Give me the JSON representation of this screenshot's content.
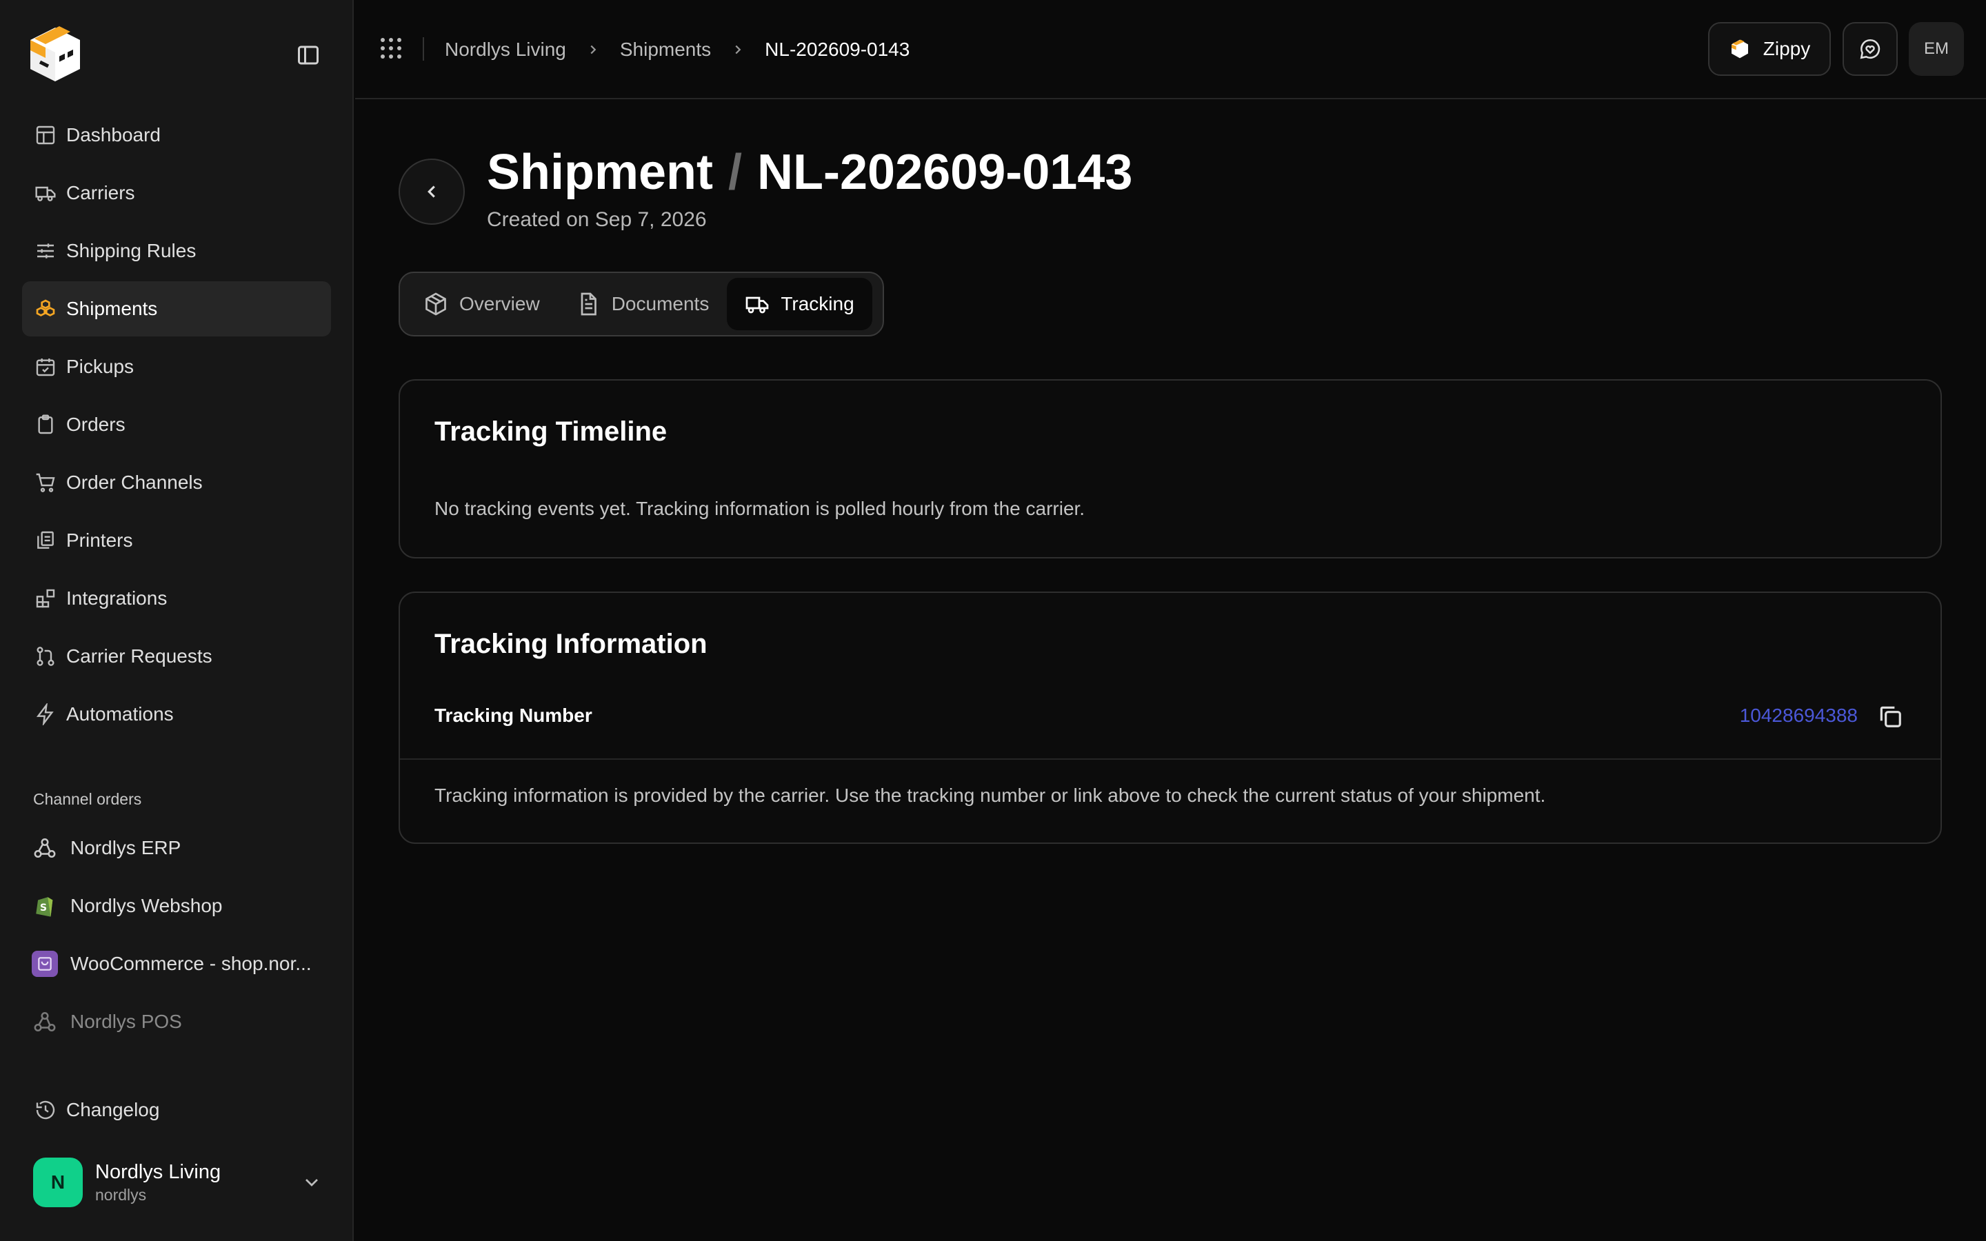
{
  "sidebar": {
    "nav": [
      {
        "label": "Dashboard",
        "icon": "dashboard-icon"
      },
      {
        "label": "Carriers",
        "icon": "truck-icon"
      },
      {
        "label": "Shipping Rules",
        "icon": "sliders-icon"
      },
      {
        "label": "Shipments",
        "icon": "boxes-icon",
        "active": true
      },
      {
        "label": "Pickups",
        "icon": "calendar-check-icon"
      },
      {
        "label": "Orders",
        "icon": "clipboard-icon"
      },
      {
        "label": "Order Channels",
        "icon": "cart-icon"
      },
      {
        "label": "Printers",
        "icon": "printer-icon"
      },
      {
        "label": "Integrations",
        "icon": "blocks-icon"
      },
      {
        "label": "Carrier Requests",
        "icon": "git-pull-icon"
      },
      {
        "label": "Automations",
        "icon": "bolt-icon"
      }
    ],
    "channel_section_label": "Channel orders",
    "channels": [
      {
        "label": "Nordlys ERP",
        "icon": "webhook-icon"
      },
      {
        "label": "Nordlys Webshop",
        "icon": "shopify-icon"
      },
      {
        "label": "WooCommerce - shop.nor...",
        "icon": "woocommerce-icon"
      },
      {
        "label": "Nordlys POS",
        "icon": "webhook-icon"
      }
    ],
    "changelog_label": "Changelog",
    "account": {
      "initial": "N",
      "name": "Nordlys Living",
      "slug": "nordlys"
    }
  },
  "topbar": {
    "breadcrumbs": [
      "Nordlys Living",
      "Shipments",
      "NL-202609-0143"
    ],
    "zippy_label": "Zippy",
    "user_initials": "EM"
  },
  "header": {
    "title": "Shipment",
    "title_sep": "/",
    "shipment_id": "NL-202609-0143",
    "created": "Created on Sep 7, 2026"
  },
  "tabs": [
    {
      "label": "Overview",
      "icon": "package-icon"
    },
    {
      "label": "Documents",
      "icon": "document-icon"
    },
    {
      "label": "Tracking",
      "icon": "truck-icon",
      "active": true
    }
  ],
  "timeline": {
    "title": "Tracking Timeline",
    "empty_text": "No tracking events yet. Tracking information is polled hourly from the carrier."
  },
  "tracking_info": {
    "title": "Tracking Information",
    "number_label": "Tracking Number",
    "number_value": "10428694388",
    "note": "Tracking information is provided by the carrier. Use the tracking number or link above to check the current status of your shipment."
  },
  "colors": {
    "accent": "#f5a623",
    "avatar": "#10d08a",
    "link": "#4b58d8"
  }
}
